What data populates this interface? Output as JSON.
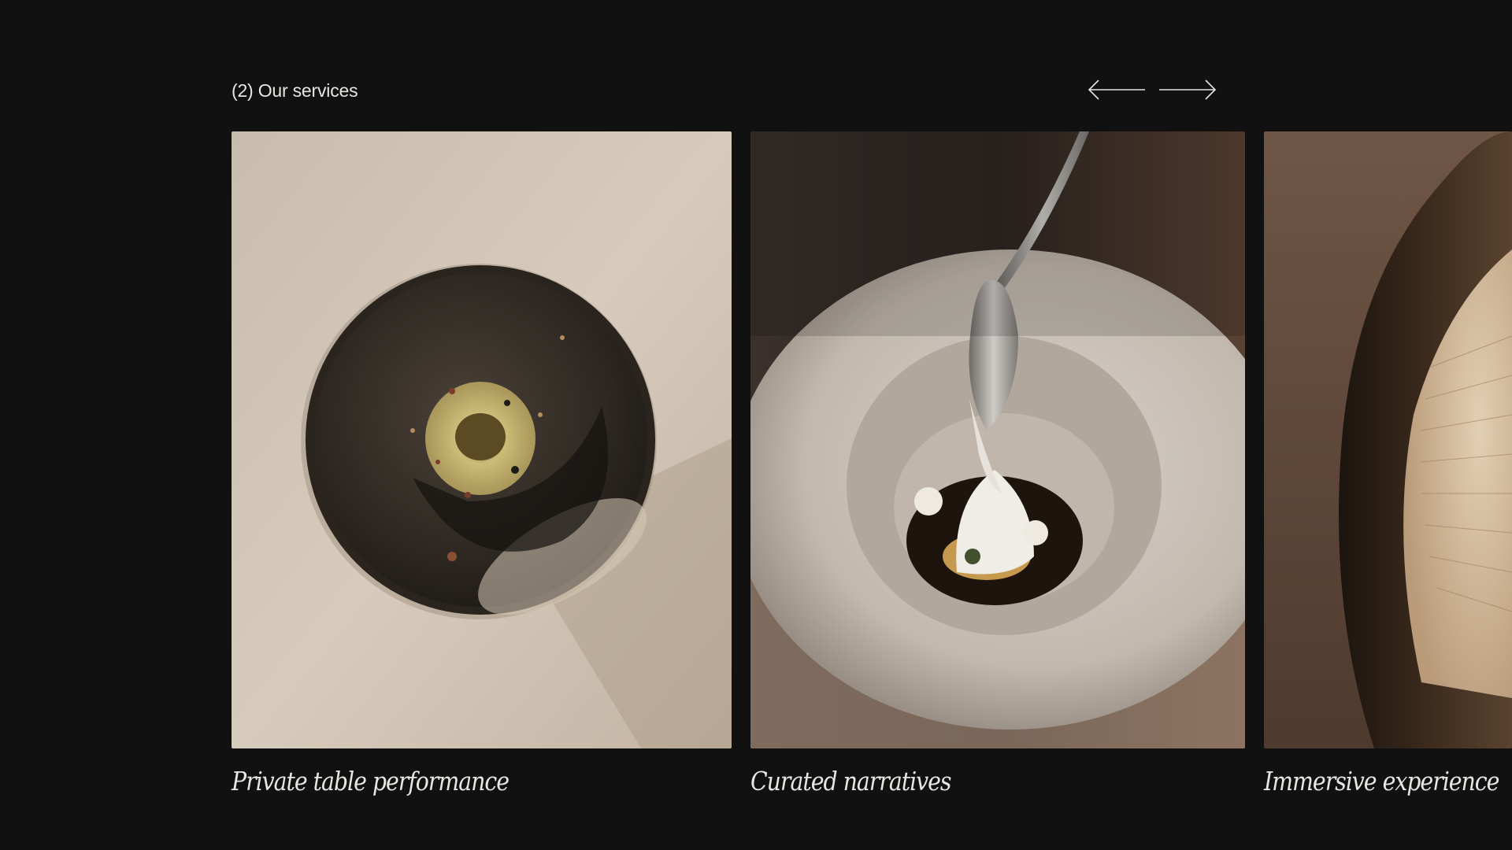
{
  "section": {
    "label": "(2) Our services"
  },
  "navigation": {
    "prev_icon": "arrow-left-icon",
    "next_icon": "arrow-right-icon",
    "color": "#e8e6e1"
  },
  "services": [
    {
      "caption": "Private table performance",
      "image": "dark-plate-dessert-photo"
    },
    {
      "caption": "Curated  narratives",
      "image": "spoon-foam-bowl-photo"
    },
    {
      "caption": "Immersive experience",
      "image": "mushroom-closeup-photo"
    }
  ],
  "colors": {
    "background": "#111111",
    "text": "#e8e6e1"
  }
}
